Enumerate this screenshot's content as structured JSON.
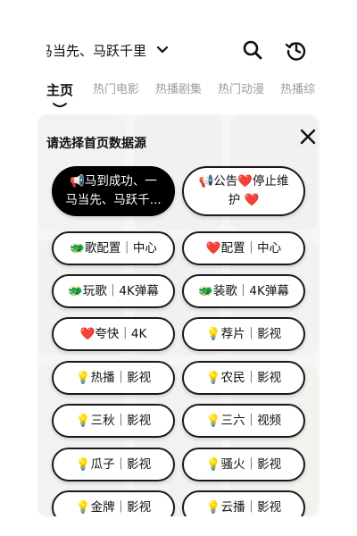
{
  "header": {
    "source_title": "马到成功、一马当先、马跃千里",
    "chevron_icon": "chevron-down-icon",
    "search_icon": "search-icon",
    "history_icon": "history-icon"
  },
  "tabs": [
    {
      "label": "主页",
      "active": true
    },
    {
      "label": "热门电影",
      "active": false
    },
    {
      "label": "热播剧集",
      "active": false
    },
    {
      "label": "热门动漫",
      "active": false
    },
    {
      "label": "热播综",
      "active": false
    }
  ],
  "overlay": {
    "title": "请选择首页数据源",
    "close_icon": "close-icon"
  },
  "sources": [
    {
      "text": "📢马到成功、一马当先、马跃千...",
      "selected": true
    },
    {
      "text": "📢公告❤️停止维护 ❤️",
      "selected": false
    },
    {
      "text": "🐲歌配置｜中心",
      "selected": false
    },
    {
      "text": "❤️配置｜中心",
      "selected": false
    },
    {
      "text": "🐲玩歌｜4K弹幕",
      "selected": false
    },
    {
      "text": "🐲装歌｜4K弹幕",
      "selected": false
    },
    {
      "text": "❤️夸快｜4K",
      "selected": false
    },
    {
      "text": "💡荐片｜影视",
      "selected": false
    },
    {
      "text": "💡热播｜影视",
      "selected": false
    },
    {
      "text": "💡农民｜影视",
      "selected": false
    },
    {
      "text": "💡三秋｜影视",
      "selected": false
    },
    {
      "text": "💡三六｜视频",
      "selected": false
    },
    {
      "text": "💡瓜子｜影视",
      "selected": false
    },
    {
      "text": "💡骚火｜影视",
      "selected": false
    },
    {
      "text": "💡金牌｜影视",
      "selected": false
    },
    {
      "text": "💡云播｜影视",
      "selected": false
    }
  ],
  "colors": {
    "selected_bg": "#000000",
    "pill_border": "#1a1a1a",
    "inactive_tab": "#9c9c9c"
  }
}
